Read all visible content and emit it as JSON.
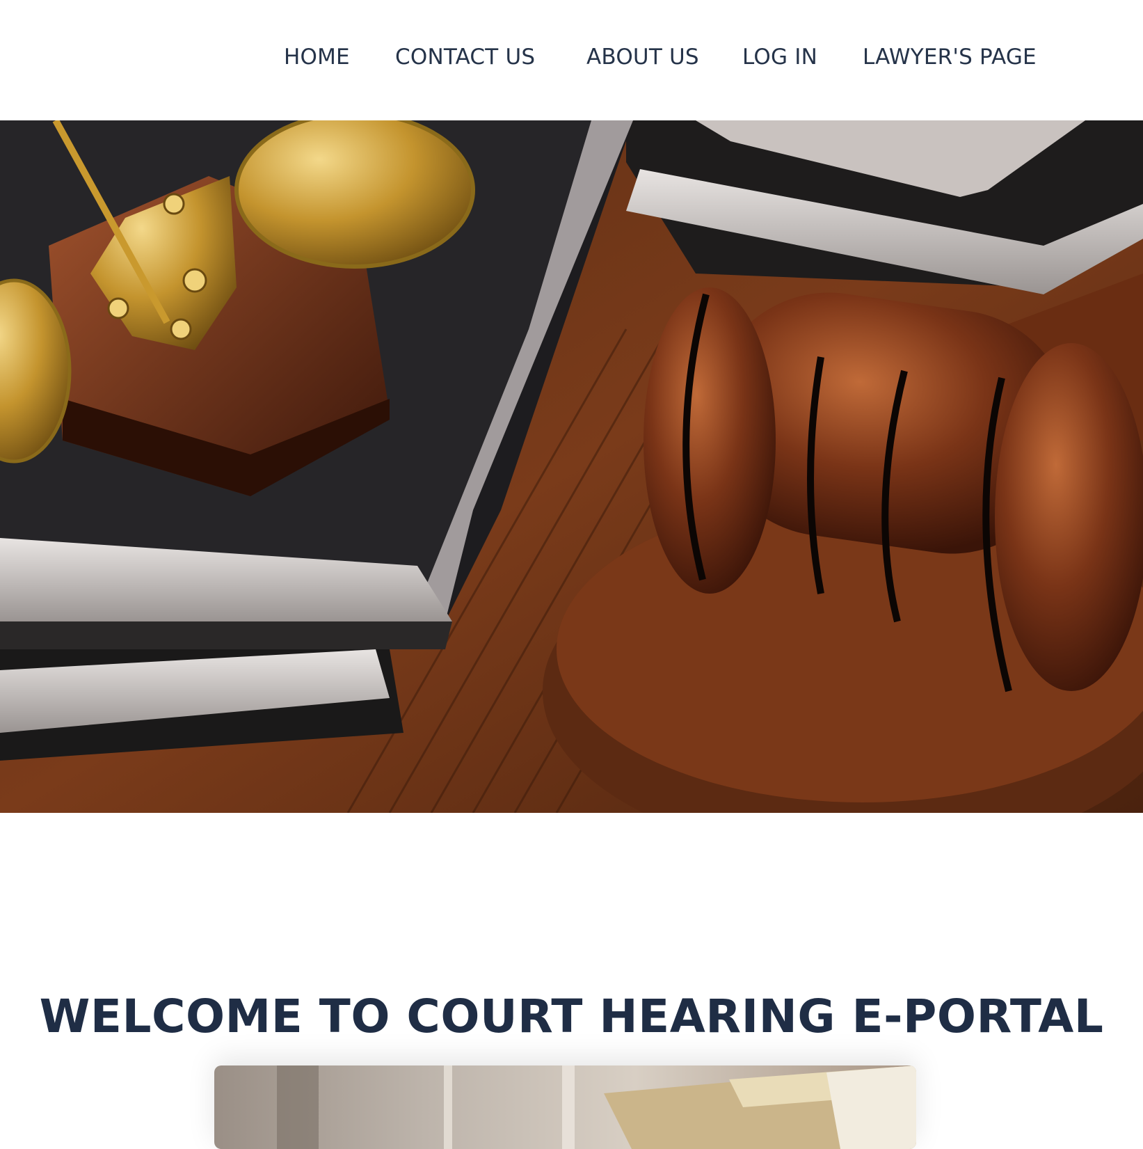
{
  "nav": {
    "items": [
      {
        "label": "HOME"
      },
      {
        "label": "CONTACT US"
      },
      {
        "label": "ABOUT US"
      },
      {
        "label": "LOG IN"
      },
      {
        "label": "LAWYER'S PAGE"
      }
    ]
  },
  "hero": {
    "image": "gavel-scales-books-photo"
  },
  "main": {
    "welcome_title": "WELCOME TO COURT HEARING E-PORTAL",
    "feature_image": "law-books-photo"
  },
  "colors": {
    "nav_text": "#253349",
    "heading_text": "#1f2d45",
    "background": "#ffffff"
  }
}
